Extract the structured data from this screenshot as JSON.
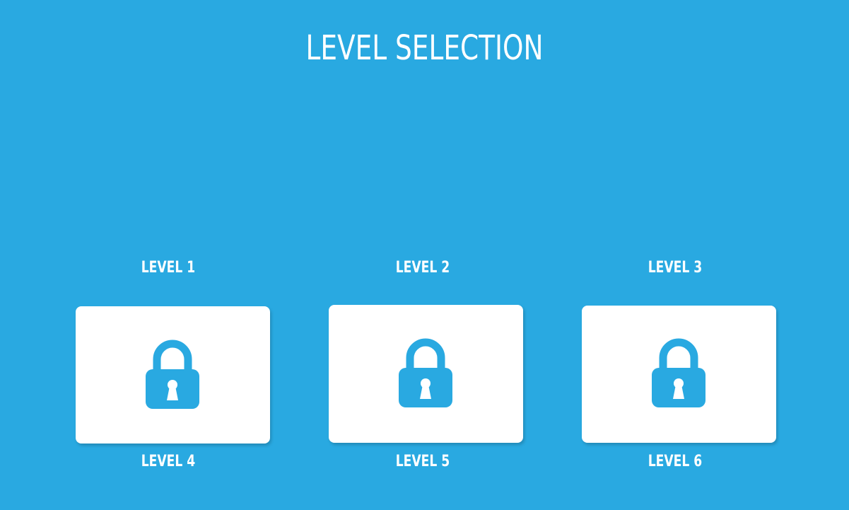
{
  "title": "LEVEL SELECTION",
  "colors": {
    "background": "#29a9e1",
    "card": "#ffffff",
    "lock": "#29a9e1",
    "text": "#ffffff"
  },
  "levels": [
    {
      "label": "LEVEL 1",
      "locked": true,
      "icon": "lock-icon"
    },
    {
      "label": "LEVEL 2",
      "locked": true,
      "icon": "lock-icon"
    },
    {
      "label": "LEVEL 3",
      "locked": true,
      "icon": "lock-icon"
    },
    {
      "label": "LEVEL 4"
    },
    {
      "label": "LEVEL 5"
    },
    {
      "label": "LEVEL 6"
    }
  ]
}
